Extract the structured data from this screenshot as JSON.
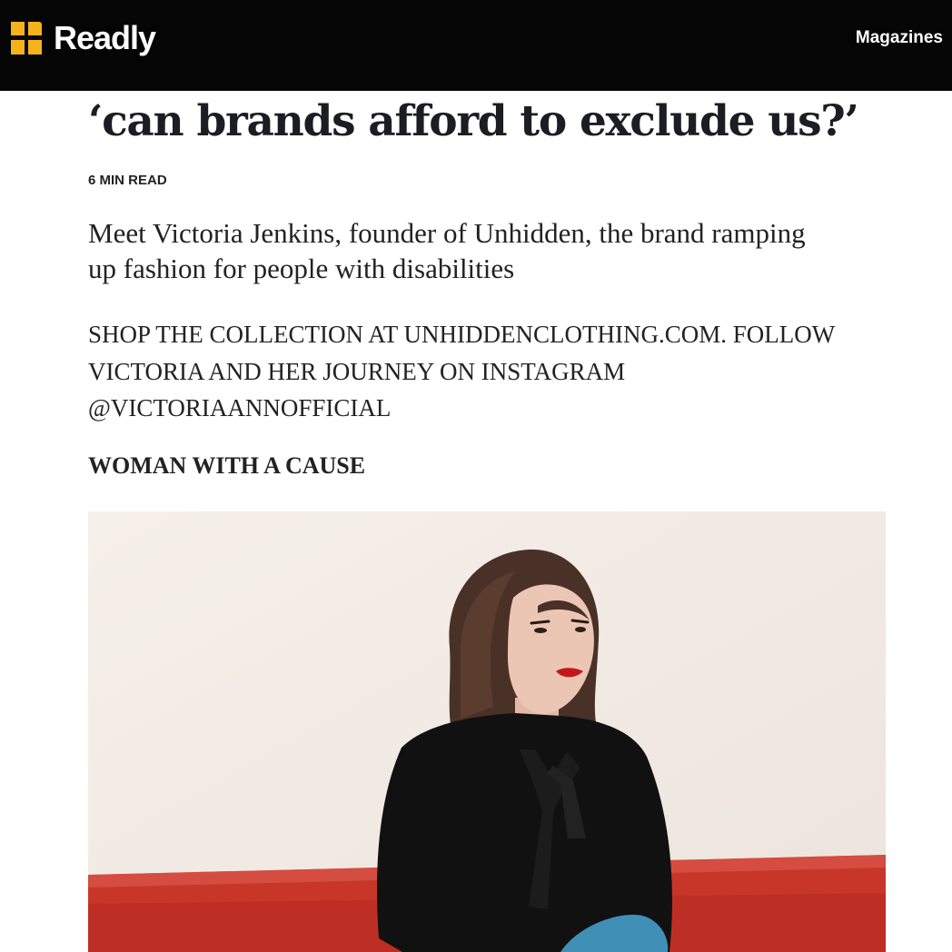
{
  "header": {
    "brand_name": "Readly",
    "brand_color": "#f5b21a",
    "background": "#050505",
    "logo_icon": "readly-logo-icon",
    "nav_magazines": "Magazines"
  },
  "article": {
    "headline": "‘can brands afford to exclude us?’",
    "read_time": "6 MIN READ",
    "standfirst": "Meet Victoria Jenkins, founder of Unhidden, the brand ramping up fashion for people with disabilities",
    "credit": "SHOP THE COLLECTION AT UNHIDDENCLOTHING.COM. FOLLOW VICTORIA AND HER JOURNEY ON INSTAGRAM @VICTORIAANNOFFICIAL",
    "subhead": "WOMAN WITH A CAUSE"
  },
  "photo": {
    "description_icon": "portrait-photo",
    "colors": {
      "wall": "#f4eee8",
      "sofa": "#c8362a",
      "top": "#111111",
      "hair": "#4a3128",
      "skin": "#ecc6b4",
      "lips": "#c41818",
      "jeans": "#3f8fb6"
    }
  }
}
